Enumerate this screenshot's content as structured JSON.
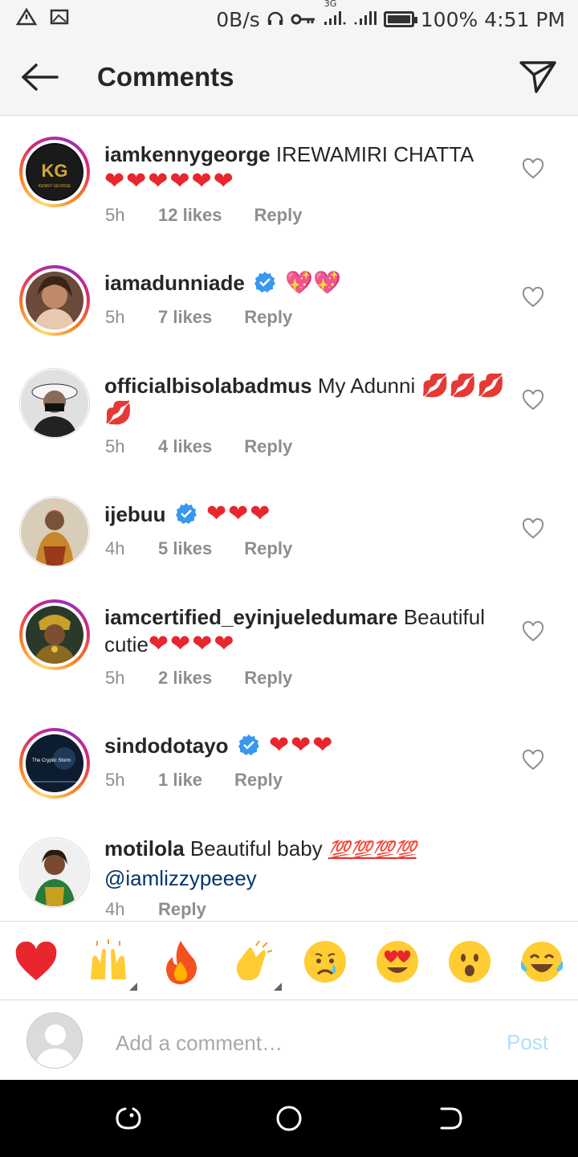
{
  "status_bar": {
    "network_speed": "0B/s",
    "network_type": "3G",
    "battery_percent": "100%",
    "battery_level": 1.0,
    "time": "4:51 PM",
    "icons": [
      "warning-icon",
      "image-icon",
      "headphones-icon",
      "vpn-key-icon",
      "signal-icon",
      "signal-icon",
      "battery-icon"
    ]
  },
  "header": {
    "title": "Comments"
  },
  "comments": [
    {
      "username": "iamkennygeorge",
      "verified": false,
      "text": " IREWAMIRI CHATTA",
      "emojis": "❤❤❤❤❤❤",
      "time": "5h",
      "likes": "12 likes",
      "reply": "Reply"
    },
    {
      "username": "iamadunniade",
      "verified": true,
      "text": "",
      "emojis": "💖💖",
      "time": "5h",
      "likes": "7 likes",
      "reply": "Reply"
    },
    {
      "username": "officialbisolabadmus",
      "verified": false,
      "text": " My Adunni ",
      "emojis": "💋💋💋💋",
      "time": "5h",
      "likes": "4 likes",
      "reply": "Reply"
    },
    {
      "username": "ijebuu",
      "verified": true,
      "text": "",
      "emojis": "❤❤❤",
      "time": "4h",
      "likes": "5 likes",
      "reply": "Reply"
    },
    {
      "username": "iamcertified_eyinjueledumare",
      "verified": false,
      "text": " Beautiful cutie",
      "emojis": "❤❤❤❤",
      "time": "5h",
      "likes": "2 likes",
      "reply": "Reply"
    },
    {
      "username": "sindodotayo",
      "verified": true,
      "text": "",
      "emojis": "❤❤❤",
      "time": "5h",
      "likes": "1 like",
      "reply": "Reply"
    },
    {
      "username": "motilola",
      "verified": false,
      "text": " Beautiful baby ",
      "emojis": "💯💯💯💯",
      "mention": "@iamlizzypeeey",
      "time": "4h",
      "likes": "",
      "reply": "Reply"
    }
  ],
  "avatar_texts": {
    "kenny_logo": "KG",
    "kenny_name": "KENNY GEORGE",
    "sindo_title": "The Cryptic Storm"
  },
  "reactions": [
    {
      "name": "red-heart",
      "emoji": "❤️",
      "tones": false
    },
    {
      "name": "raising-hands",
      "emoji": "🙌",
      "tones": true
    },
    {
      "name": "fire",
      "emoji": "🔥",
      "tones": false
    },
    {
      "name": "clapping-hands",
      "emoji": "👏",
      "tones": true
    },
    {
      "name": "crying-face",
      "emoji": "😢",
      "tones": false
    },
    {
      "name": "heart-eyes",
      "emoji": "😍",
      "tones": false
    },
    {
      "name": "surprised-face",
      "emoji": "😮",
      "tones": false
    },
    {
      "name": "tears-of-joy",
      "emoji": "😂",
      "tones": false
    }
  ],
  "comment_input": {
    "placeholder": "Add a comment…",
    "post_label": "Post"
  },
  "colors": {
    "username": "#262626",
    "meta": "#8e8e8e",
    "verified_blue": "#3897f0",
    "post_disabled": "#b2dffc",
    "mention": "#003569",
    "heart_red": "#e8262d"
  }
}
